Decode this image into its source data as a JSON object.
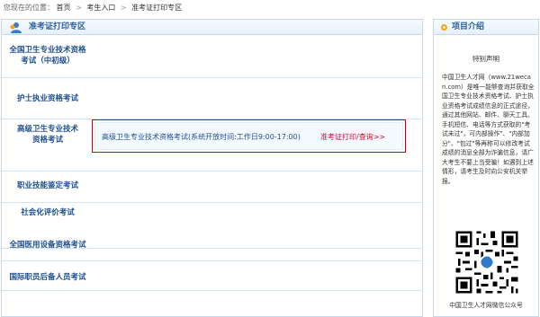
{
  "breadcrumb": {
    "prefix": "您现在的位置：",
    "home": "首页",
    "separator": ">",
    "level1": "考生入口",
    "level2": "准考证打印专区"
  },
  "left_panel": {
    "title": "准考证打印专区",
    "categories": [
      {
        "line1": "全国卫生专业技术资格",
        "line2": "考试（中初级）"
      },
      {
        "line1": "护士执业资格考试",
        "line2": ""
      },
      {
        "line1": "高级卫生专业技术",
        "line2": "资格考试"
      },
      {
        "line1": "职业技能鉴定考试",
        "line2": ""
      },
      {
        "line1": "社会化评价考试",
        "line2": ""
      },
      {
        "line1": "全国医用设备资格考试",
        "line2": ""
      },
      {
        "line1": "国际职员后备人员考试",
        "line2": ""
      }
    ],
    "popup": {
      "exam_text": "高级卫生专业技术资格考试(系统开放时间:工作日9:00-17:00)",
      "link_text": "准考证打印/查询>>"
    }
  },
  "right_panel": {
    "title": "项目介绍",
    "notice_title": "特别声明",
    "notice_body": "中国卫生人才网（www.21wecan.com）是唯一能够查询并获取全国卫生专业技术资格考试、护士执业资格考试成绩信息的正式途径，通过其他网站、邮件、聊天工具、手机短信、电话等方式获取的\"考试未过\"，可内部操作\"、\"内部加分\"、\"包过\"等再称可以修改考试成绩的消息全部为诈骗信息，请广大考生不要上当受骗！如遇到上述情形，请考生及时向公安机关举报。",
    "qr_caption": "中国卫生人才网微信公众号"
  },
  "colors": {
    "accent_blue": "#1d4f91",
    "alert_red": "#e4002b",
    "border": "#c9d9ec"
  }
}
